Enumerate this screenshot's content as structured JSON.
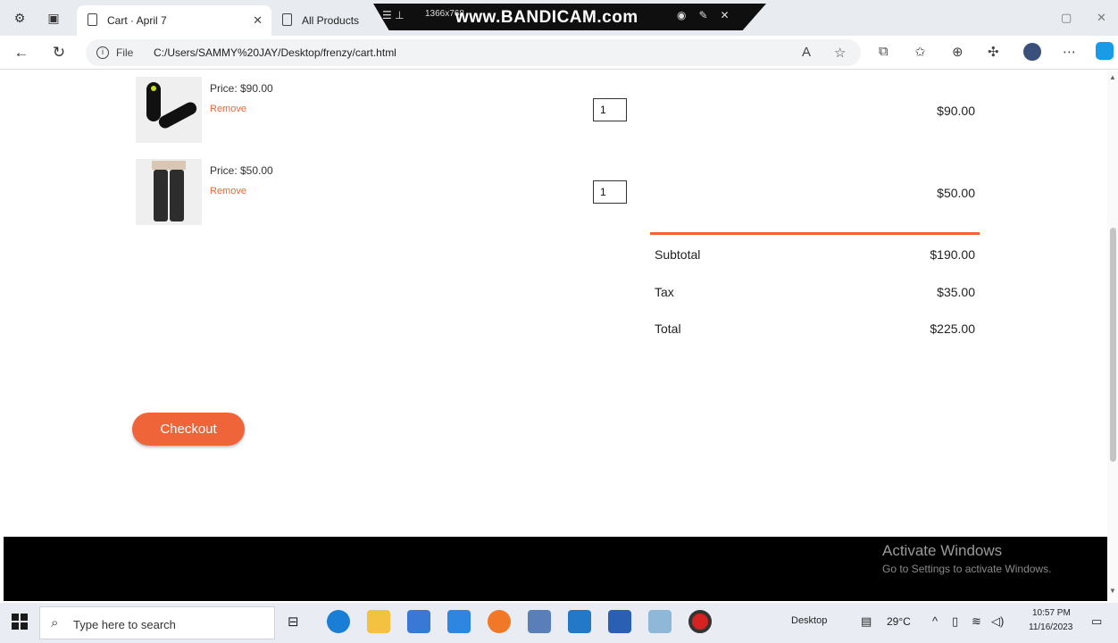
{
  "browser": {
    "tabs": [
      {
        "title": "Cart · April 7",
        "active": true
      },
      {
        "title": "All Products",
        "active": false
      }
    ],
    "address": {
      "scheme_label": "File",
      "url": "C:/Users/SAMMY%20JAY/Desktop/frenzy/cart.html"
    }
  },
  "recorder": {
    "brand": "www.BANDICAM.com",
    "resolution": "1366x768"
  },
  "cart": {
    "items": [
      {
        "price": "Price: $90.00",
        "remove": "Remove",
        "qty": "1",
        "subtotal": "$90.00",
        "image": "black-sneakers"
      },
      {
        "price": "Price: $50.00",
        "remove": "Remove",
        "qty": "1",
        "subtotal": "$50.00",
        "image": "black-trousers"
      }
    ],
    "summary": {
      "subtotal_label": "Subtotal",
      "subtotal_value": "$190.00",
      "tax_label": "Tax",
      "tax_value": "$35.00",
      "total_label": "Total",
      "total_value": "$225.00"
    },
    "checkout_label": "Checkout",
    "accent_color": "#f0643a"
  },
  "watermark": {
    "title": "Activate Windows",
    "subtitle": "Go to Settings to activate Windows."
  },
  "taskbar": {
    "search_placeholder": "Type here to search",
    "desktop_label": "Desktop",
    "temperature": "29°C",
    "time": "10:57 PM",
    "date": "11/16/2023"
  }
}
